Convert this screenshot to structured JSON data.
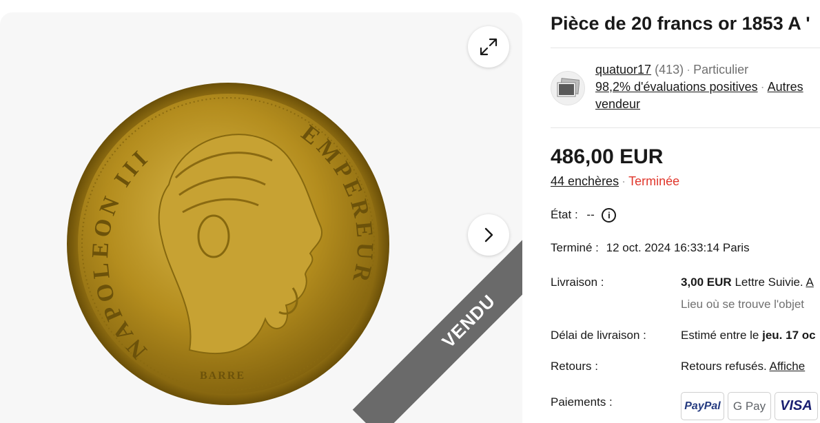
{
  "gallery": {
    "expand_icon": "expand-arrows-icon",
    "next_icon": "chevron-right-icon",
    "sold_label": "VENDU",
    "coin_legend_left": "NAPOLEON III",
    "coin_legend_right": "EMPEREUR",
    "coin_engraver": "BARRE"
  },
  "listing": {
    "title": "Pièce de 20 francs or 1853 A '"
  },
  "seller": {
    "name": "quatuor17",
    "count": "(413)",
    "type": "Particulier",
    "feedback": "98,2% d'évaluations positives",
    "other_items": "Autres",
    "seller_word": "vendeur"
  },
  "price": {
    "amount": "486,00 EUR",
    "bids": "44 enchères",
    "status": "Terminée"
  },
  "details": {
    "condition_label": "État :",
    "condition_value": "--",
    "ended_label": "Terminé :",
    "ended_value": "12 oct. 2024 16:33:14 Paris",
    "shipping_label": "Livraison :",
    "shipping_price": "3,00 EUR",
    "shipping_method": "Lettre Suivie.",
    "shipping_more": "A",
    "item_location": "Lieu où se trouve l'objet",
    "delivery_label": "Délai de livraison :",
    "delivery_prefix": "Estimé entre le",
    "delivery_date": "jeu. 17 oc",
    "returns_label": "Retours :",
    "returns_value": "Retours refusés.",
    "returns_link": "Affiche",
    "payments_label": "Paiements :",
    "payments": [
      "PayPal",
      "G Pay",
      "VISA"
    ]
  },
  "colors": {
    "ended_red": "#e0362b",
    "sold_banner": "#6a6a6a",
    "gold": "#c9a227"
  }
}
